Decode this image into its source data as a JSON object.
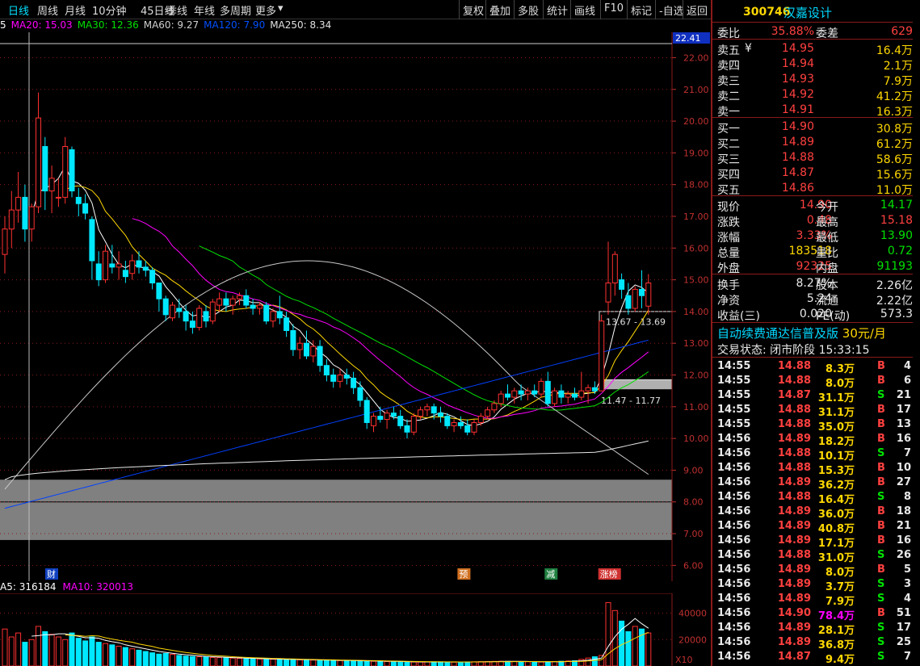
{
  "toolbar": {
    "periods": [
      "日线",
      "周线",
      "月线",
      "10分钟",
      "45日线",
      "季线",
      "年线",
      "多周期",
      "更多"
    ],
    "active_period": "日线",
    "more_arrow": "▾",
    "tools": [
      "复权",
      "叠加",
      "多股",
      "统计",
      "画线",
      "F10",
      "标记",
      "-自选",
      "返回"
    ]
  },
  "ma_legend": [
    {
      "label": "5",
      "color": "#ffffff"
    },
    {
      "label": "MA20: 15.03",
      "color": "#ff00ff"
    },
    {
      "label": "MA30: 12.36",
      "color": "#00e000"
    },
    {
      "label": "MA60: 9.27",
      "color": "#d0d0d0"
    },
    {
      "label": "MA120: 7.90",
      "color": "#0050ff"
    },
    {
      "label": "MA250: 8.34",
      "color": "#e0e0e0"
    }
  ],
  "chart_data": {
    "type": "candlestick",
    "ylim": [
      5.5,
      22.8
    ],
    "y_ticks": [
      "22.00",
      "21.00",
      "20.00",
      "19.00",
      "18.00",
      "17.00",
      "16.00",
      "15.00",
      "14.00",
      "13.00",
      "12.00",
      "11.00",
      "10.00",
      "9.00",
      "8.00",
      "7.00",
      "6.00"
    ],
    "price_top_label": "22.41",
    "range_labels": [
      "13.67 - 13.69",
      "11.47 - 11.77"
    ],
    "event_markers": [
      {
        "label": "财",
        "i": -1
      },
      {
        "label": "预",
        "i": 68
      },
      {
        "label": "减",
        "i": 81
      },
      {
        "label": "涨榜",
        "i": 89
      }
    ],
    "candles": [
      [
        15.8,
        17.0,
        15.2,
        16.6
      ],
      [
        16.6,
        17.8,
        16.0,
        17.2
      ],
      [
        17.2,
        18.4,
        16.8,
        17.6
      ],
      [
        17.6,
        18.0,
        16.2,
        16.6
      ],
      [
        16.6,
        17.4,
        16.2,
        17.3
      ],
      [
        17.3,
        20.9,
        17.1,
        20.1
      ],
      [
        19.2,
        19.5,
        17.2,
        17.8
      ],
      [
        17.8,
        18.6,
        17.1,
        18.2
      ],
      [
        17.6,
        18.2,
        17.3,
        17.6
      ],
      [
        17.6,
        19.5,
        17.4,
        19.2
      ],
      [
        19.1,
        19.2,
        17.6,
        17.8
      ],
      [
        17.6,
        17.9,
        17.0,
        17.4
      ],
      [
        17.4,
        17.7,
        16.9,
        17.1
      ],
      [
        16.9,
        17.0,
        15.0,
        15.6
      ],
      [
        15.5,
        15.9,
        14.8,
        15.0
      ],
      [
        15.0,
        16.1,
        14.9,
        15.9
      ],
      [
        15.5,
        16.1,
        15.2,
        15.4
      ],
      [
        15.4,
        15.9,
        15.0,
        15.5
      ],
      [
        15.3,
        15.6,
        14.9,
        15.1
      ],
      [
        15.2,
        15.8,
        15.0,
        15.6
      ],
      [
        15.6,
        15.9,
        15.2,
        15.4
      ],
      [
        15.4,
        15.6,
        15.1,
        15.3
      ],
      [
        15.3,
        15.4,
        14.7,
        14.9
      ],
      [
        14.9,
        14.9,
        14.0,
        14.4
      ],
      [
        14.4,
        14.5,
        13.7,
        13.9
      ],
      [
        13.8,
        14.3,
        13.7,
        14.2
      ],
      [
        14.1,
        14.4,
        13.8,
        14.0
      ],
      [
        14.0,
        14.2,
        13.4,
        13.7
      ],
      [
        13.7,
        14.0,
        13.3,
        13.5
      ],
      [
        13.5,
        14.2,
        13.4,
        14.1
      ],
      [
        14.0,
        14.2,
        13.5,
        13.7
      ],
      [
        13.7,
        14.4,
        13.6,
        14.3
      ],
      [
        14.2,
        14.6,
        14.0,
        14.4
      ],
      [
        14.4,
        14.6,
        14.0,
        14.2
      ],
      [
        14.2,
        14.5,
        13.9,
        14.4
      ],
      [
        14.4,
        14.6,
        14.2,
        14.5
      ],
      [
        14.5,
        14.7,
        14.1,
        14.2
      ],
      [
        14.2,
        14.4,
        13.9,
        14.1
      ],
      [
        14.1,
        14.3,
        13.9,
        14.2
      ],
      [
        14.2,
        14.3,
        13.6,
        13.7
      ],
      [
        13.7,
        14.1,
        13.5,
        14.0
      ],
      [
        14.0,
        14.5,
        13.6,
        13.8
      ],
      [
        13.8,
        14.0,
        13.2,
        13.4
      ],
      [
        13.4,
        13.6,
        12.6,
        12.8
      ],
      [
        12.8,
        13.2,
        12.5,
        13.0
      ],
      [
        13.0,
        13.4,
        12.5,
        12.6
      ],
      [
        12.6,
        13.1,
        12.4,
        12.9
      ],
      [
        12.9,
        13.1,
        12.1,
        12.3
      ],
      [
        12.3,
        12.5,
        11.8,
        12.0
      ],
      [
        12.0,
        12.2,
        11.6,
        11.8
      ],
      [
        11.8,
        12.2,
        11.6,
        12.0
      ],
      [
        12.0,
        12.2,
        11.7,
        11.9
      ],
      [
        11.9,
        12.1,
        11.4,
        11.6
      ],
      [
        11.6,
        11.8,
        11.0,
        11.2
      ],
      [
        11.2,
        11.3,
        10.3,
        10.5
      ],
      [
        10.4,
        10.8,
        10.2,
        10.7
      ],
      [
        10.7,
        11.0,
        10.5,
        10.6
      ],
      [
        10.6,
        10.9,
        10.3,
        10.8
      ],
      [
        10.8,
        11.0,
        10.6,
        10.7
      ],
      [
        10.7,
        10.9,
        10.3,
        10.4
      ],
      [
        10.4,
        10.6,
        10.0,
        10.2
      ],
      [
        10.2,
        10.8,
        10.1,
        10.7
      ],
      [
        10.7,
        11.0,
        10.6,
        10.9
      ],
      [
        10.9,
        11.1,
        10.7,
        11.0
      ],
      [
        11.0,
        11.1,
        10.6,
        10.8
      ],
      [
        10.8,
        11.0,
        10.5,
        10.7
      ],
      [
        10.7,
        10.8,
        10.3,
        10.4
      ],
      [
        10.4,
        10.6,
        10.2,
        10.5
      ],
      [
        10.5,
        10.7,
        10.3,
        10.4
      ],
      [
        10.4,
        10.6,
        10.1,
        10.2
      ],
      [
        10.2,
        10.6,
        10.1,
        10.5
      ],
      [
        10.5,
        10.8,
        10.4,
        10.7
      ],
      [
        10.7,
        11.0,
        10.6,
        10.9
      ],
      [
        10.9,
        11.2,
        10.8,
        11.1
      ],
      [
        11.1,
        11.5,
        11.0,
        11.4
      ],
      [
        11.4,
        11.7,
        11.2,
        11.3
      ],
      [
        11.3,
        11.6,
        11.1,
        11.5
      ],
      [
        11.5,
        11.7,
        11.2,
        11.4
      ],
      [
        11.4,
        11.6,
        11.2,
        11.5
      ],
      [
        11.5,
        11.7,
        11.3,
        11.4
      ],
      [
        11.4,
        11.9,
        11.3,
        11.8
      ],
      [
        11.8,
        12.1,
        11.0,
        11.1
      ],
      [
        11.1,
        11.6,
        11.0,
        11.5
      ],
      [
        11.5,
        11.7,
        11.1,
        11.3
      ],
      [
        11.3,
        11.5,
        11.1,
        11.4
      ],
      [
        11.4,
        11.6,
        11.2,
        11.3
      ],
      [
        11.3,
        12.1,
        11.2,
        11.5
      ],
      [
        11.5,
        11.7,
        11.1,
        11.6
      ],
      [
        11.6,
        11.8,
        11.4,
        11.5
      ],
      [
        11.5,
        13.9,
        11.5,
        13.7
      ],
      [
        14.3,
        16.2,
        13.9,
        14.9
      ],
      [
        14.9,
        15.9,
        14.5,
        15.8
      ],
      [
        15.0,
        15.2,
        14.4,
        14.7
      ],
      [
        14.5,
        14.9,
        13.9,
        14.1
      ],
      [
        14.1,
        14.8,
        14.0,
        14.7
      ],
      [
        14.7,
        15.3,
        14.1,
        14.5
      ],
      [
        14.17,
        15.18,
        13.9,
        14.9
      ]
    ],
    "vol_legend": [
      {
        "label": "A5: 316184",
        "color": "#ffffff"
      },
      {
        "label": "MA10: 320013",
        "color": "#ff00ff"
      }
    ],
    "vol_ticks": [
      "40000",
      "20000"
    ],
    "vol_unit": "X10",
    "vol_ylim": [
      0,
      55000
    ],
    "volumes": [
      28000,
      22000,
      25000,
      18000,
      20000,
      30000,
      26000,
      24000,
      22000,
      20000,
      25000,
      21000,
      19000,
      22000,
      18000,
      17000,
      16000,
      15000,
      14000,
      13000,
      12000,
      11000,
      10000,
      9000,
      9500,
      8800,
      8000,
      7500,
      7200,
      7000,
      6800,
      6500,
      6400,
      6200,
      6000,
      5800,
      5600,
      5400,
      5300,
      5200,
      5100,
      5000,
      4900,
      4800,
      4700,
      4600,
      4500,
      4400,
      4300,
      4200,
      4100,
      4000,
      3900,
      3800,
      3700,
      3600,
      3500,
      3400,
      3300,
      3200,
      3100,
      3000,
      3000,
      3100,
      3200,
      3100,
      3000,
      2900,
      3000,
      3100,
      3200,
      3300,
      3400,
      3500,
      3600,
      3500,
      3400,
      3300,
      3200,
      3100,
      3000,
      3200,
      3400,
      3600,
      3800,
      4000,
      5000,
      6000,
      7000,
      8000,
      48000,
      42000,
      34000,
      26000,
      30000,
      28000,
      25000
    ]
  },
  "quote": {
    "code": "300746",
    "name": "汉嘉设计",
    "wei_bi_label": "委比",
    "wei_bi": "35.88%",
    "wei_cha_label": "委差",
    "wei_cha": "629",
    "asks": [
      {
        "label": "卖五",
        "mark": "¥",
        "price": "14.95",
        "vol": "16.4万"
      },
      {
        "label": "卖四",
        "mark": "",
        "price": "14.94",
        "vol": "2.1万"
      },
      {
        "label": "卖三",
        "mark": "",
        "price": "14.93",
        "vol": "7.9万"
      },
      {
        "label": "卖二",
        "mark": "",
        "price": "14.92",
        "vol": "41.2万"
      },
      {
        "label": "卖一",
        "mark": "",
        "price": "14.91",
        "vol": "16.3万"
      }
    ],
    "bids": [
      {
        "label": "买一",
        "price": "14.90",
        "vol": "30.8万"
      },
      {
        "label": "买二",
        "price": "14.89",
        "vol": "61.2万"
      },
      {
        "label": "买三",
        "price": "14.88",
        "vol": "58.6万"
      },
      {
        "label": "买四",
        "price": "14.87",
        "vol": "15.6万"
      },
      {
        "label": "买五",
        "price": "14.86",
        "vol": "11.0万"
      }
    ],
    "stats": [
      {
        "l1": "现价",
        "v1": "14.90",
        "c1": "red",
        "l2": "今开",
        "v2": "14.17",
        "c2": "green"
      },
      {
        "l1": "涨跌",
        "v1": "0.48",
        "c1": "red",
        "l2": "最高",
        "v2": "15.18",
        "c2": "red"
      },
      {
        "l1": "涨幅",
        "v1": "3.33%",
        "c1": "red",
        "l2": "最低",
        "v2": "13.90",
        "c2": "green"
      },
      {
        "l1": "总量",
        "v1": "183518",
        "c1": "yellow",
        "l2": "量比",
        "v2": "0.72",
        "c2": "green"
      },
      {
        "l1": "外盘",
        "v1": "92325",
        "c1": "red",
        "l2": "内盘",
        "v2": "91193",
        "c2": "green"
      }
    ],
    "stats2": [
      {
        "l1": "换手",
        "v1": "8.27%",
        "l2": "股本",
        "v2": "2.26亿"
      },
      {
        "l1": "净资",
        "v1": "5.24",
        "l2": "流通",
        "v2": "2.22亿"
      },
      {
        "l1": "收益(三)",
        "v1": "0.020",
        "l2": "PE(动)",
        "v2": "573.3"
      }
    ],
    "promo_text": "自动续费通达信普及版",
    "promo_price": "30元/月",
    "trade_status": "交易状态: 闭市阶段 15:33:15"
  },
  "ticks": [
    {
      "t": "14:55",
      "p": "14.88",
      "v": "8.3万",
      "s": "B",
      "n": "4"
    },
    {
      "t": "14:55",
      "p": "14.88",
      "v": "8.0万",
      "s": "B",
      "n": "6"
    },
    {
      "t": "14:55",
      "p": "14.87",
      "v": "31.1万",
      "s": "S",
      "n": "21"
    },
    {
      "t": "14:55",
      "p": "14.88",
      "v": "31.1万",
      "s": "B",
      "n": "17"
    },
    {
      "t": "14:55",
      "p": "14.88",
      "v": "35.0万",
      "s": "B",
      "n": "13"
    },
    {
      "t": "14:56",
      "p": "14.89",
      "v": "18.2万",
      "s": "B",
      "n": "16"
    },
    {
      "t": "14:56",
      "p": "14.88",
      "v": "10.1万",
      "s": "S",
      "n": "7"
    },
    {
      "t": "14:56",
      "p": "14.88",
      "v": "15.3万",
      "s": "B",
      "n": "10"
    },
    {
      "t": "14:56",
      "p": "14.89",
      "v": "36.2万",
      "s": "B",
      "n": "27"
    },
    {
      "t": "14:56",
      "p": "14.88",
      "v": "16.4万",
      "s": "S",
      "n": "8"
    },
    {
      "t": "14:56",
      "p": "14.89",
      "v": "36.0万",
      "s": "B",
      "n": "18"
    },
    {
      "t": "14:56",
      "p": "14.89",
      "v": "40.8万",
      "s": "B",
      "n": "21"
    },
    {
      "t": "14:56",
      "p": "14.89",
      "v": "17.1万",
      "s": "B",
      "n": "16"
    },
    {
      "t": "14:56",
      "p": "14.88",
      "v": "31.0万",
      "s": "S",
      "n": "26"
    },
    {
      "t": "14:56",
      "p": "14.89",
      "v": "8.0万",
      "s": "B",
      "n": "5"
    },
    {
      "t": "14:56",
      "p": "14.89",
      "v": "3.7万",
      "s": "S",
      "n": "3"
    },
    {
      "t": "14:56",
      "p": "14.89",
      "v": "7.9万",
      "s": "S",
      "n": "4"
    },
    {
      "t": "14:56",
      "p": "14.90",
      "v": "78.4万",
      "s": "B",
      "n": "51",
      "big": true
    },
    {
      "t": "14:56",
      "p": "14.89",
      "v": "28.1万",
      "s": "S",
      "n": "17"
    },
    {
      "t": "14:56",
      "p": "14.89",
      "v": "36.8万",
      "s": "S",
      "n": "25"
    },
    {
      "t": "14:56",
      "p": "14.87",
      "v": "9.4万",
      "s": "S",
      "n": "7"
    }
  ]
}
